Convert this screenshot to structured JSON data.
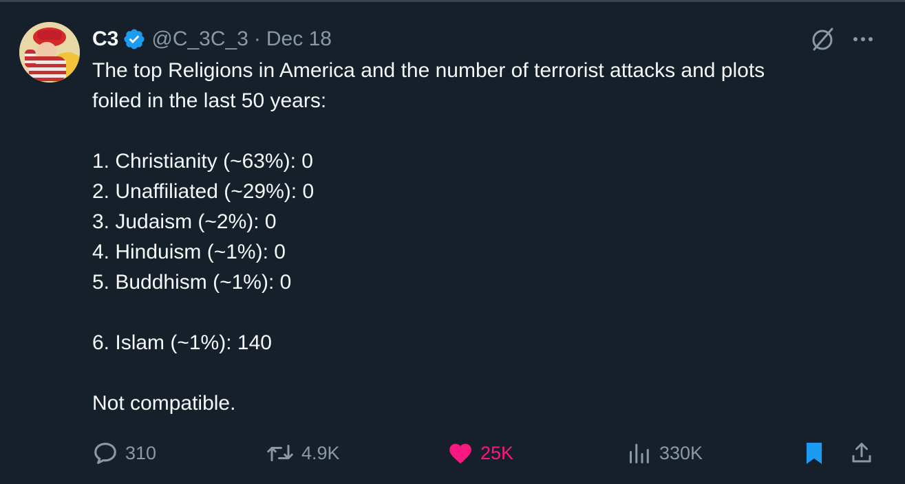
{
  "author": {
    "name": "C3",
    "handle": "@C_3C_3",
    "separator": "·",
    "date": "Dec 18"
  },
  "tweet": {
    "lines": [
      "The top Religions in America and the number of terrorist attacks and plots",
      "foiled in the last 50 years:",
      "1. Christianity (~63%): 0",
      "2. Unaffiliated (~29%): 0",
      "3. Judaism (~2%): 0",
      "4. Hinduism (~1%): 0",
      "5. Buddhism (~1%): 0",
      "6. Islam (~1%): 140",
      "Not compatible."
    ]
  },
  "metrics": {
    "replies": "310",
    "reposts": "4.9K",
    "likes": "25K",
    "views": "330K"
  },
  "icons": [
    "verified-badge-icon",
    "grok-icon",
    "more-icon",
    "reply-icon",
    "repost-icon",
    "like-icon",
    "views-icon",
    "bookmark-icon",
    "share-icon"
  ],
  "colors": {
    "background": "#15202b",
    "text": "#f7f9f9",
    "secondary": "#8b98a5",
    "verified": "#1d9bf0",
    "like": "#f91880",
    "bookmark": "#1d9bf0"
  }
}
